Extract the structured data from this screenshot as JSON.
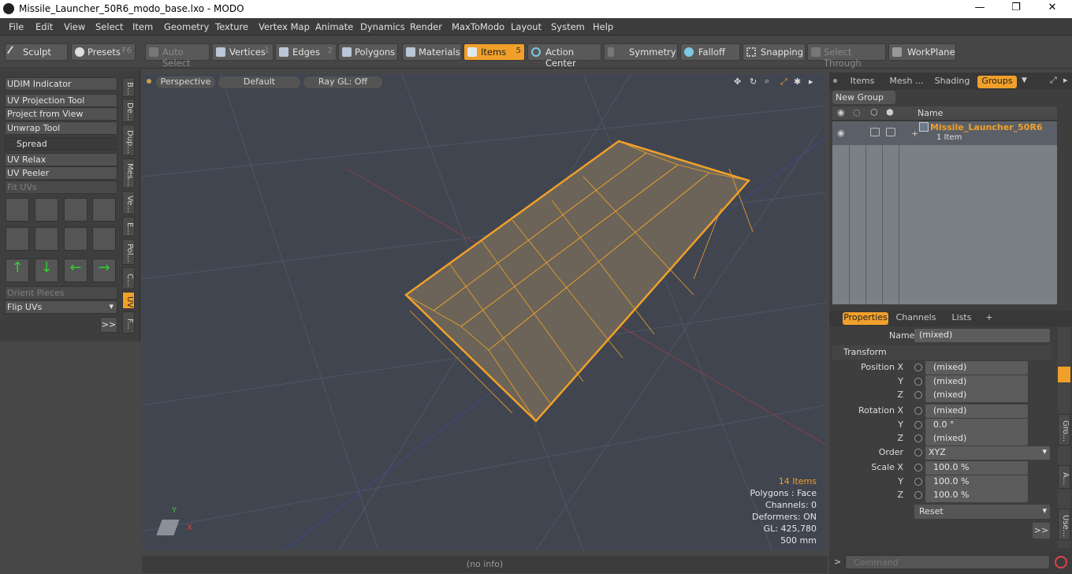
{
  "window": {
    "title": "Missile_Launcher_50R6_modo_base.lxo - MODO",
    "controls": [
      "—",
      "❐",
      "✕"
    ]
  },
  "menu": [
    "File",
    "Edit",
    "View",
    "Select",
    "Item",
    "Geometry",
    "Texture",
    "Vertex Map",
    "Animate",
    "Dynamics",
    "Render",
    "MaxToModo",
    "Layout",
    "System",
    "Help"
  ],
  "toolbar": {
    "sculpt": "Sculpt",
    "presets": "Presets",
    "presets_key": "F6",
    "auto_select": "Auto Select",
    "vertices": "Vertices",
    "vertices_key": "1",
    "edges": "Edges",
    "edges_key": "2",
    "polygons": "Polygons",
    "materials": "Materials",
    "items": "Items",
    "items_key": "5",
    "action_center": "Action Center",
    "symmetry": "Symmetry",
    "falloff": "Falloff",
    "snapping": "Snapping",
    "select_through": "Select Through",
    "workplane": "WorkPlane"
  },
  "left": {
    "udim": "UDIM Indicator",
    "uv_projection": "UV Projection Tool",
    "project_from_view": "Project from View",
    "unwrap": "Unwrap Tool",
    "spread": "Spread",
    "uv_relax": "UV Relax",
    "uv_peeler": "UV Peeler",
    "fit_uvs": "Fit UVs",
    "orient_pieces": "Orient Pieces",
    "flip_uvs": "Flip UVs",
    "more": ">>",
    "vtabs": [
      "B...",
      "De...",
      "Dup...",
      "Mes...",
      "Ve...",
      "E...",
      "Pol...",
      "C...",
      "UV",
      "F..."
    ]
  },
  "viewport": {
    "perspective": "Perspective",
    "default": "Default",
    "raygl": "Ray GL: Off",
    "info": [
      "14 Items",
      "Polygons : Face",
      "Channels: 0",
      "Deformers: ON",
      "GL: 425,780",
      "500 mm"
    ],
    "axis_x": "X",
    "axis_y": "Y"
  },
  "groups_panel": {
    "tabs": [
      "Items",
      "Mesh ...",
      "Shading",
      "Groups"
    ],
    "new_group": "New Group",
    "col_name": "Name",
    "item_name": "Missile_Launcher_50R6",
    "item_count": "1 Item"
  },
  "properties": {
    "tabs": [
      "Properties",
      "Channels",
      "Lists",
      "+"
    ],
    "name_label": "Name",
    "name_value": "(mixed)",
    "transform": "Transform",
    "rows": [
      {
        "label": "Position X",
        "value": "(mixed)"
      },
      {
        "label": "Y",
        "value": "(mixed)"
      },
      {
        "label": "Z",
        "value": "(mixed)"
      },
      {
        "label": "Rotation X",
        "value": "(mixed)"
      },
      {
        "label": "Y",
        "value": "0.0 °"
      },
      {
        "label": "Z",
        "value": "(mixed)"
      },
      {
        "label": "Order",
        "value": "XYZ"
      },
      {
        "label": "Scale X",
        "value": "100.0 %"
      },
      {
        "label": "Y",
        "value": "100.0 %"
      },
      {
        "label": "Z",
        "value": "100.0 %"
      }
    ],
    "reset": "Reset",
    "more": ">>",
    "side_tabs": [
      "Gro...",
      "A...",
      "Use..."
    ]
  },
  "status": "(no info)",
  "command_placeholder": "Command",
  "accent": "#f0a02a"
}
